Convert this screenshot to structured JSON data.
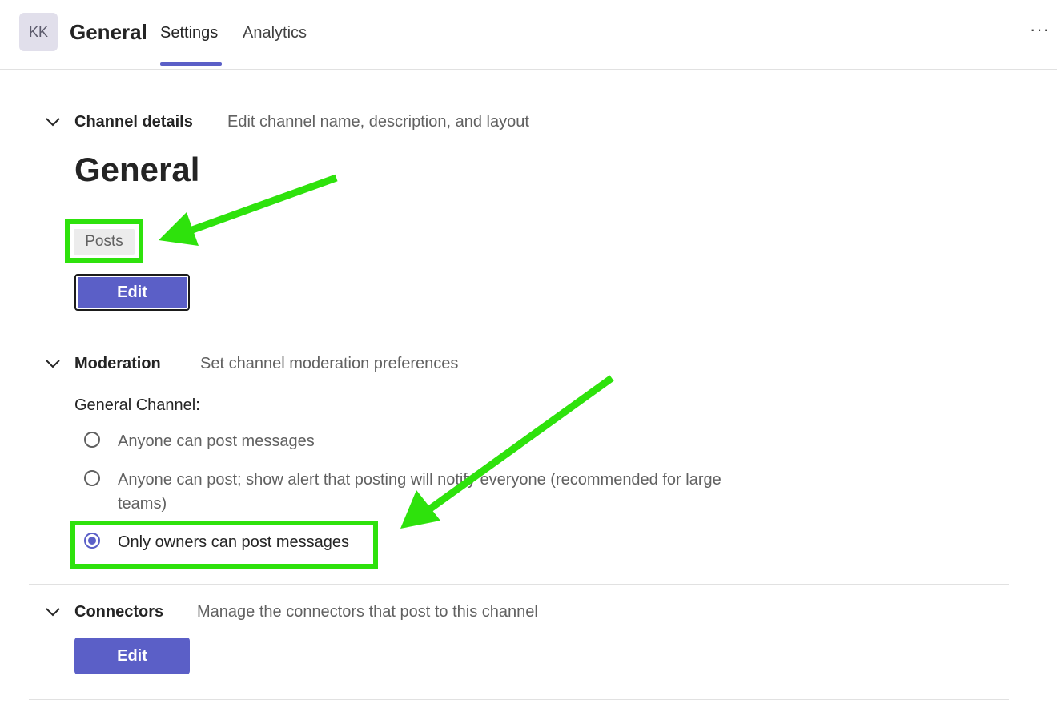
{
  "header": {
    "avatar_initials": "KK",
    "channel_name": "General",
    "tabs": [
      {
        "label": "Settings",
        "active": true
      },
      {
        "label": "Analytics",
        "active": false
      }
    ],
    "more_label": "···"
  },
  "channel_details": {
    "title": "Channel details",
    "description": "Edit channel name, description, and layout",
    "name": "General",
    "layout_tag": "Posts",
    "edit_label": "Edit"
  },
  "moderation": {
    "title": "Moderation",
    "description": "Set channel moderation preferences",
    "channel_label": "General Channel:",
    "options": [
      {
        "label": "Anyone can post messages",
        "checked": false
      },
      {
        "label": "Anyone can post; show alert that posting will notify everyone (recommended for large teams)",
        "checked": false
      },
      {
        "label": "Only owners can post messages",
        "checked": true
      }
    ]
  },
  "connectors": {
    "title": "Connectors",
    "description": "Manage the connectors that post to this channel",
    "edit_label": "Edit"
  },
  "colors": {
    "accent": "#5b5fc7",
    "annotation": "#2ee20c",
    "divider": "#e1e1e1"
  }
}
